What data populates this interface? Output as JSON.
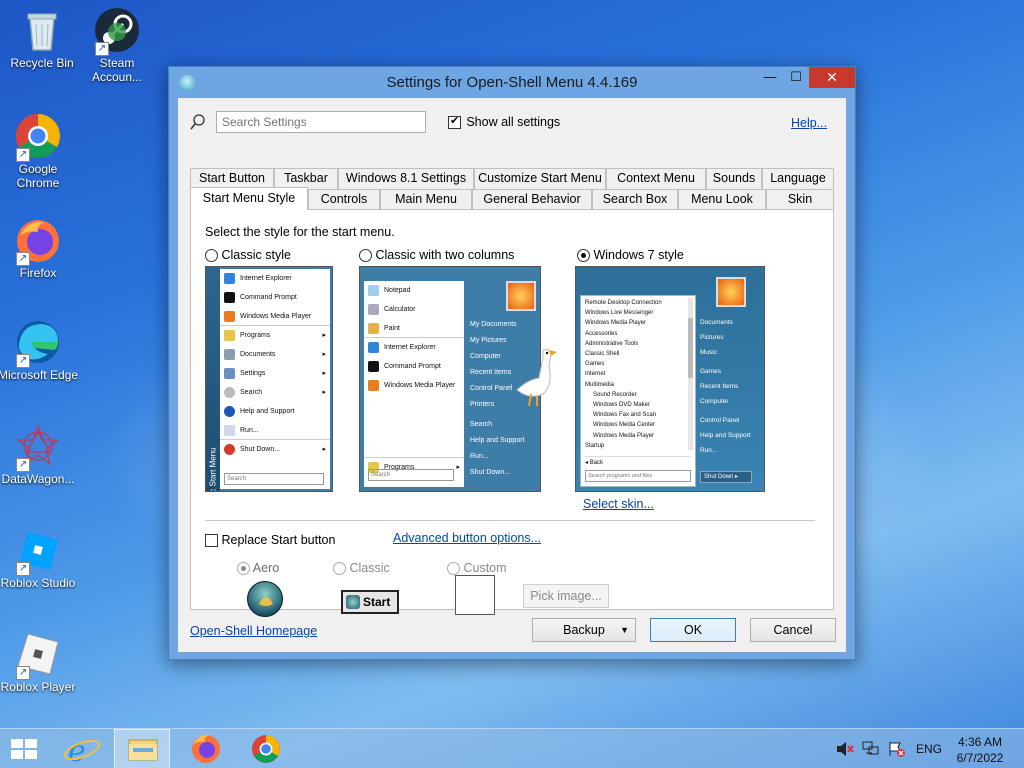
{
  "desktop_icons": [
    {
      "label": "Recycle Bin",
      "icon": "recycle-bin-icon"
    },
    {
      "label": "Steam Accoun...",
      "icon": "steam-icon"
    },
    {
      "label": "Google Chrome",
      "icon": "chrome-icon"
    },
    {
      "label": "Firefox",
      "icon": "firefox-icon"
    },
    {
      "label": "Microsoft Edge",
      "icon": "edge-icon"
    },
    {
      "label": "DataWagon...",
      "icon": "datawagon-icon"
    },
    {
      "label": "Roblox Studio",
      "icon": "roblox-studio-icon"
    },
    {
      "label": "Roblox Player",
      "icon": "roblox-player-icon"
    }
  ],
  "window": {
    "title": "Settings for Open-Shell Menu 4.4.169",
    "search_placeholder": "Search Settings",
    "show_all_label": "Show all settings",
    "help_link": "Help...",
    "tabs_row1": [
      "Start Button",
      "Taskbar",
      "Windows 8.1 Settings",
      "Customize Start Menu",
      "Context Menu",
      "Sounds",
      "Language"
    ],
    "tabs_row2": [
      "Start Menu Style",
      "Controls",
      "Main Menu",
      "General Behavior",
      "Search Box",
      "Menu Look",
      "Skin"
    ],
    "prompt": "Select the style for the start menu.",
    "styles": [
      {
        "label": "Classic style",
        "selected": false
      },
      {
        "label": "Classic with two columns",
        "selected": false
      },
      {
        "label": "Windows 7 style",
        "selected": true
      }
    ],
    "classic_preview": {
      "items": [
        "Internet Explorer",
        "Command Prompt",
        "Windows Media Player",
        "Programs",
        "Documents",
        "Settings",
        "Search",
        "Help and Support",
        "Run...",
        "Shut Down..."
      ],
      "side_label": "Classic Start Menu",
      "search": "Search"
    },
    "two_col_preview": {
      "left": [
        "Notepad",
        "Calculator",
        "Paint",
        "Internet Explorer",
        "Command Prompt",
        "Windows Media Player"
      ],
      "programs": "Programs",
      "right": [
        "My Documents",
        "My Pictures",
        "Computer",
        "Recent Items",
        "Control Panel",
        "Printers",
        "Search",
        "Help and Support",
        "Run...",
        "Shut Down..."
      ],
      "search": "Search"
    },
    "win7_preview": {
      "left": [
        "Remote Desktop Connection",
        "Windows Live Messenger",
        "Windows Media Player",
        "Accessories",
        "Administrative Tools",
        "Classic Shell",
        "Games",
        "Internet",
        "Multimedia",
        "Sound Recorder",
        "Windows DVD Maker",
        "Windows Fax and Scan",
        "Windows Media Center",
        "Windows Media Player",
        "Startup"
      ],
      "back": "Back",
      "search": "Search programs and files",
      "right": [
        "Documents",
        "Pictures",
        "Music",
        "Games",
        "Recent Items",
        "Computer",
        "Control Panel",
        "Help and Support",
        "Run..."
      ],
      "shutdown": "Shut Down"
    },
    "select_skin": "Select skin...",
    "replace_start_label": "Replace Start button",
    "advanced_button": "Advanced button options...",
    "button_styles": [
      {
        "label": "Aero",
        "selected": true
      },
      {
        "label": "Classic",
        "selected": false
      },
      {
        "label": "Custom",
        "selected": false
      }
    ],
    "classic_start_text": "Start",
    "pick_image": "Pick image...",
    "homepage_link": "Open-Shell Homepage",
    "backup_button": "Backup",
    "ok_button": "OK",
    "cancel_button": "Cancel"
  },
  "taskbar": {
    "language": "ENG",
    "time": "4:36 AM",
    "date": "6/7/2022"
  }
}
